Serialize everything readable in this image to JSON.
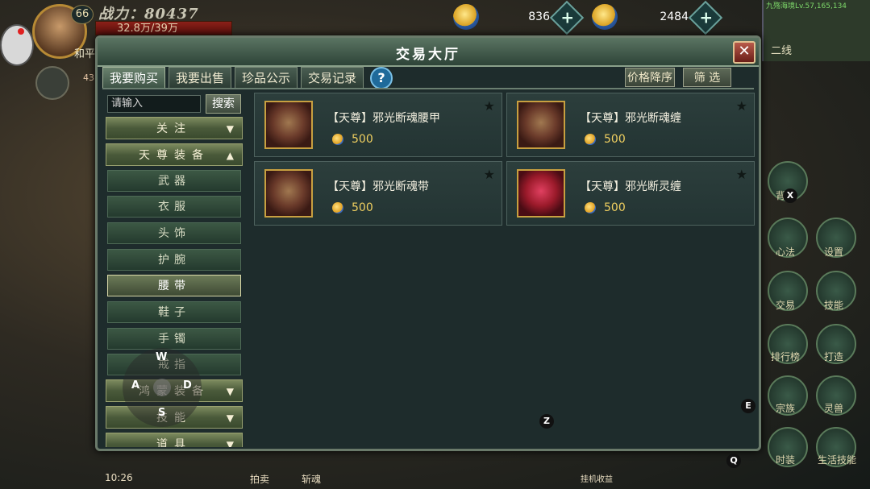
{
  "hud": {
    "level": "66",
    "power": "战力：80437",
    "hp": "32.8万/39万",
    "name": "和平",
    "second_level": "43",
    "currency1_value": "836",
    "currency2_value": "2484",
    "minimap_location": "九殇海境Lv.57,165,134",
    "line": "二线",
    "battery_time": "10:26",
    "bottom_labels": [
      "拍卖",
      "斩魂",
      "挂机收益"
    ],
    "side_buttons": [
      "背包",
      "心法",
      "设置",
      "交易",
      "技能",
      "排行榜",
      "打造",
      "宗族",
      "灵兽",
      "时装",
      "生活技能"
    ],
    "overlay_keys": {
      "w": "W",
      "a": "A",
      "s": "S",
      "d": "D",
      "x": "X",
      "z": "Z",
      "e": "E",
      "q": "Q"
    }
  },
  "dialog": {
    "title": "交易大厅",
    "close": "✕",
    "tabs": [
      "我要购买",
      "我要出售",
      "珍品公示",
      "交易记录"
    ],
    "help": "?",
    "sort_button": "价格降序",
    "filter_button": "筛 选",
    "search_placeholder": "请输入",
    "search_button": "搜索",
    "categories": {
      "follow": "关注",
      "tianzun": "天尊装备",
      "hongmeng": "鸿蒙装备",
      "skill": "技能",
      "item": "道具"
    },
    "subcategories": [
      "武器",
      "衣服",
      "头饰",
      "护腕",
      "腰带",
      "鞋子",
      "手镯",
      "戒指"
    ],
    "selected_sub": "腰带",
    "items": [
      {
        "name": "【天尊】邪光断魂腰甲",
        "price": "500"
      },
      {
        "name": "【天尊】邪光断魂缠",
        "price": "500"
      },
      {
        "name": "【天尊】邪光断魂带",
        "price": "500"
      },
      {
        "name": "【天尊】邪光断灵缠",
        "price": "500"
      }
    ]
  },
  "colors": {
    "accent": "#6a826e",
    "price": "#f0d060"
  }
}
